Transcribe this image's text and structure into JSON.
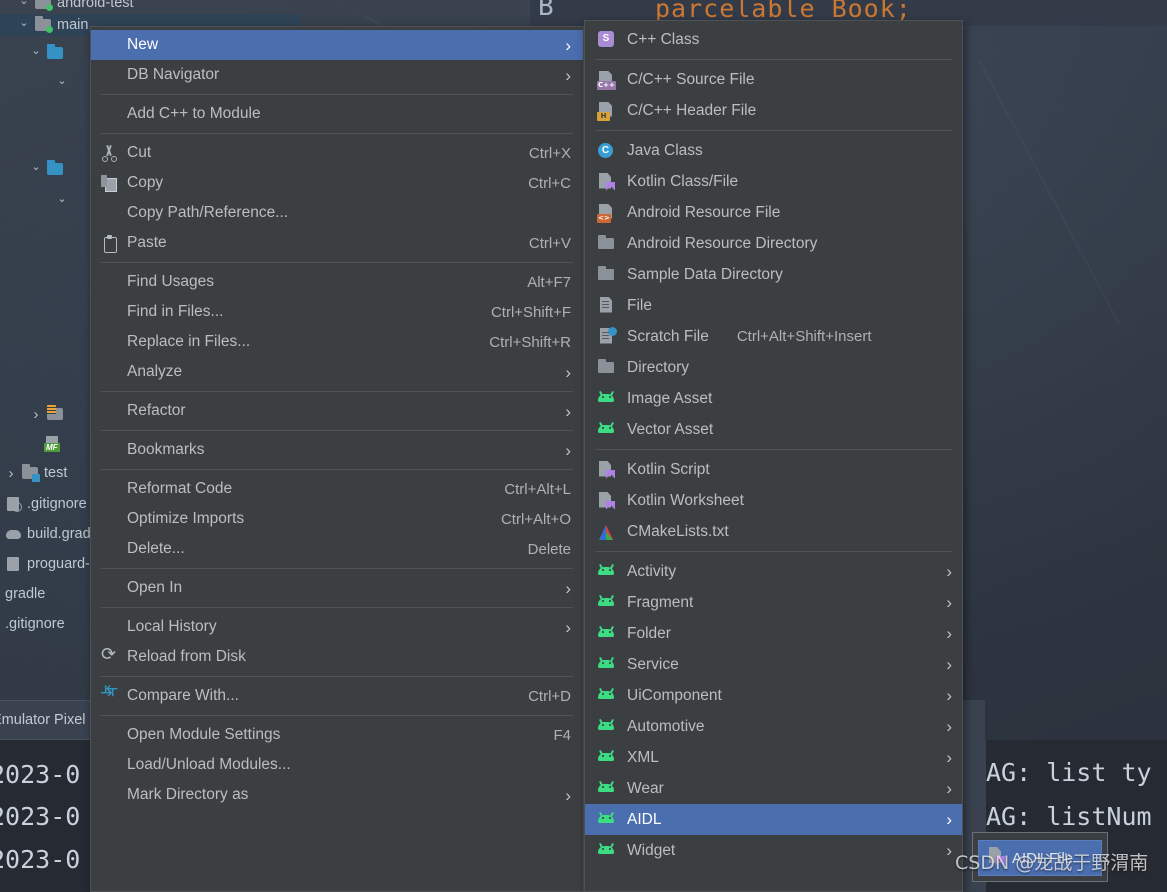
{
  "background": {
    "editor_code_snippet": "parcelable Book;",
    "tab_char": "B",
    "tree": [
      {
        "label": "android-test",
        "icon": "folder-module-icon",
        "chev": "",
        "selected": false
      },
      {
        "label": "main",
        "icon": "folder-module-icon",
        "chev": "down",
        "selected": true
      },
      {
        "label": "",
        "icon": "folder-blue-icon",
        "chev": "down",
        "selected": false
      },
      {
        "label": "",
        "icon": "",
        "chev": "down",
        "selected": false
      },
      {
        "label": "",
        "icon": "folder-blue-icon",
        "chev": "down",
        "selected": false
      },
      {
        "label": "",
        "icon": "",
        "chev": "down",
        "selected": false
      },
      {
        "label": "",
        "icon": "folder-resource-icon",
        "chev": "right",
        "selected": false
      },
      {
        "label": "",
        "icon": "manifest-icon",
        "chev": "",
        "selected": false
      },
      {
        "label": "test",
        "icon": "folder-test-icon",
        "chev": "right",
        "selected": false
      },
      {
        "label": ".gitignore",
        "icon": "gitignore-icon",
        "chev": "",
        "selected": false
      },
      {
        "label": "build.gradle",
        "icon": "gradle-icon",
        "chev": "",
        "selected": false
      },
      {
        "label": "proguard-rules.pro",
        "icon": "file-icon",
        "chev": "",
        "selected": false
      },
      {
        "label": "gradle",
        "icon": "",
        "chev": "",
        "selected": false
      },
      {
        "label": ".gitignore",
        "icon": "",
        "chev": "",
        "selected": false
      }
    ],
    "logcat_tab_label": "Emulator Pixel",
    "logcat_lines_left": [
      "2023-0",
      "2023-0",
      "2023-0"
    ],
    "logcat_lines_right": [
      "AG: list ty",
      "AG: listNum"
    ],
    "watermark": "CSDN @龙战于野渭南"
  },
  "colors": {
    "menu_bg": "#3c3f41",
    "menu_border": "#4e5254",
    "highlight": "#4b6eaf",
    "text": "#bdbdbd",
    "separator": "#4f5355",
    "android_green": "#3ddc84",
    "kotlin_purple": "#b07fe8",
    "xml_orange": "#cc6633",
    "java_blue": "#389fd6",
    "header_yellow": "#d8a13a",
    "cpp_purple": "#9876aa"
  },
  "context_menu": {
    "name": "project-view-context-menu",
    "items": [
      {
        "type": "item",
        "label": "New",
        "accel": "",
        "arrow": true,
        "icon": "",
        "highlighted": true,
        "mnemonic": "N"
      },
      {
        "type": "item",
        "label": "DB Navigator",
        "accel": "",
        "arrow": true,
        "icon": ""
      },
      {
        "type": "separator"
      },
      {
        "type": "item",
        "label": "Add C++ to Module",
        "accel": "",
        "arrow": false,
        "icon": ""
      },
      {
        "type": "separator"
      },
      {
        "type": "item",
        "label": "Cut",
        "accel": "Ctrl+X",
        "arrow": false,
        "icon": "cut-icon"
      },
      {
        "type": "item",
        "label": "Copy",
        "accel": "Ctrl+C",
        "arrow": false,
        "icon": "copy-icon"
      },
      {
        "type": "item",
        "label": "Copy Path/Reference...",
        "accel": "",
        "arrow": false,
        "icon": ""
      },
      {
        "type": "item",
        "label": "Paste",
        "accel": "Ctrl+V",
        "arrow": false,
        "icon": "paste-icon"
      },
      {
        "type": "separator"
      },
      {
        "type": "item",
        "label": "Find Usages",
        "accel": "Alt+F7",
        "arrow": false,
        "icon": ""
      },
      {
        "type": "item",
        "label": "Find in Files...",
        "accel": "Ctrl+Shift+F",
        "arrow": false,
        "icon": ""
      },
      {
        "type": "item",
        "label": "Replace in Files...",
        "accel": "Ctrl+Shift+R",
        "arrow": false,
        "icon": ""
      },
      {
        "type": "item",
        "label": "Analyze",
        "accel": "",
        "arrow": true,
        "icon": ""
      },
      {
        "type": "separator"
      },
      {
        "type": "item",
        "label": "Refactor",
        "accel": "",
        "arrow": true,
        "icon": ""
      },
      {
        "type": "separator"
      },
      {
        "type": "item",
        "label": "Bookmarks",
        "accel": "",
        "arrow": true,
        "icon": ""
      },
      {
        "type": "separator"
      },
      {
        "type": "item",
        "label": "Reformat Code",
        "accel": "Ctrl+Alt+L",
        "arrow": false,
        "icon": ""
      },
      {
        "type": "item",
        "label": "Optimize Imports",
        "accel": "Ctrl+Alt+O",
        "arrow": false,
        "icon": ""
      },
      {
        "type": "item",
        "label": "Delete...",
        "accel": "Delete",
        "arrow": false,
        "icon": ""
      },
      {
        "type": "separator"
      },
      {
        "type": "item",
        "label": "Open In",
        "accel": "",
        "arrow": true,
        "icon": ""
      },
      {
        "type": "separator"
      },
      {
        "type": "item",
        "label": "Local History",
        "accel": "",
        "arrow": true,
        "icon": ""
      },
      {
        "type": "item",
        "label": "Reload from Disk",
        "accel": "",
        "arrow": false,
        "icon": "reload-icon"
      },
      {
        "type": "separator"
      },
      {
        "type": "item",
        "label": "Compare With...",
        "accel": "Ctrl+D",
        "arrow": false,
        "icon": "compare-icon"
      },
      {
        "type": "separator"
      },
      {
        "type": "item",
        "label": "Open Module Settings",
        "accel": "F4",
        "arrow": false,
        "icon": ""
      },
      {
        "type": "item",
        "label": "Load/Unload Modules...",
        "accel": "",
        "arrow": false,
        "icon": ""
      },
      {
        "type": "item",
        "label": "Mark Directory as",
        "accel": "",
        "arrow": true,
        "icon": ""
      }
    ]
  },
  "new_submenu": {
    "name": "new-submenu",
    "items": [
      {
        "type": "item",
        "label": "C++ Class",
        "accel": "",
        "arrow": false,
        "icon": "cpp-class-icon"
      },
      {
        "type": "separator"
      },
      {
        "type": "item",
        "label": "C/C++ Source File",
        "accel": "",
        "arrow": false,
        "icon": "cpp-source-file-icon"
      },
      {
        "type": "item",
        "label": "C/C++ Header File",
        "accel": "",
        "arrow": false,
        "icon": "cpp-header-file-icon"
      },
      {
        "type": "separator"
      },
      {
        "type": "item",
        "label": "Java Class",
        "accel": "",
        "arrow": false,
        "icon": "java-class-icon"
      },
      {
        "type": "item",
        "label": "Kotlin Class/File",
        "accel": "",
        "arrow": false,
        "icon": "kotlin-file-icon"
      },
      {
        "type": "item",
        "label": "Android Resource File",
        "accel": "",
        "arrow": false,
        "icon": "android-resource-file-icon"
      },
      {
        "type": "item",
        "label": "Android Resource Directory",
        "accel": "",
        "arrow": false,
        "icon": "folder-icon"
      },
      {
        "type": "item",
        "label": "Sample Data Directory",
        "accel": "",
        "arrow": false,
        "icon": "folder-icon"
      },
      {
        "type": "item",
        "label": "File",
        "accel": "",
        "arrow": false,
        "icon": "file-icon"
      },
      {
        "type": "item",
        "label": "Scratch File",
        "accel": "Ctrl+Alt+Shift+Insert",
        "arrow": false,
        "icon": "scratch-file-icon"
      },
      {
        "type": "item",
        "label": "Directory",
        "accel": "",
        "arrow": false,
        "icon": "folder-icon"
      },
      {
        "type": "item",
        "label": "Image Asset",
        "accel": "",
        "arrow": false,
        "icon": "android-icon"
      },
      {
        "type": "item",
        "label": "Vector Asset",
        "accel": "",
        "arrow": false,
        "icon": "android-icon"
      },
      {
        "type": "separator"
      },
      {
        "type": "item",
        "label": "Kotlin Script",
        "accel": "",
        "arrow": false,
        "icon": "kotlin-file-icon"
      },
      {
        "type": "item",
        "label": "Kotlin Worksheet",
        "accel": "",
        "arrow": false,
        "icon": "kotlin-file-icon"
      },
      {
        "type": "item",
        "label": "CMakeLists.txt",
        "accel": "",
        "arrow": false,
        "icon": "cmake-icon"
      },
      {
        "type": "separator"
      },
      {
        "type": "item",
        "label": "Activity",
        "accel": "",
        "arrow": true,
        "icon": "android-icon"
      },
      {
        "type": "item",
        "label": "Fragment",
        "accel": "",
        "arrow": true,
        "icon": "android-icon"
      },
      {
        "type": "item",
        "label": "Folder",
        "accel": "",
        "arrow": true,
        "icon": "android-icon"
      },
      {
        "type": "item",
        "label": "Service",
        "accel": "",
        "arrow": true,
        "icon": "android-icon"
      },
      {
        "type": "item",
        "label": "UiComponent",
        "accel": "",
        "arrow": true,
        "icon": "android-icon"
      },
      {
        "type": "item",
        "label": "Automotive",
        "accel": "",
        "arrow": true,
        "icon": "android-icon"
      },
      {
        "type": "item",
        "label": "XML",
        "accel": "",
        "arrow": true,
        "icon": "android-icon"
      },
      {
        "type": "item",
        "label": "Wear",
        "accel": "",
        "arrow": true,
        "icon": "android-icon"
      },
      {
        "type": "item",
        "label": "AIDL",
        "accel": "",
        "arrow": true,
        "icon": "android-icon",
        "highlighted": true
      },
      {
        "type": "item",
        "label": "Widget",
        "accel": "",
        "arrow": true,
        "icon": "android-icon"
      }
    ]
  },
  "aidl_submenu": {
    "name": "aidl-submenu",
    "items": [
      {
        "type": "item",
        "label": "AIDL File",
        "icon": "aidl-file-icon",
        "highlighted": true
      }
    ]
  }
}
